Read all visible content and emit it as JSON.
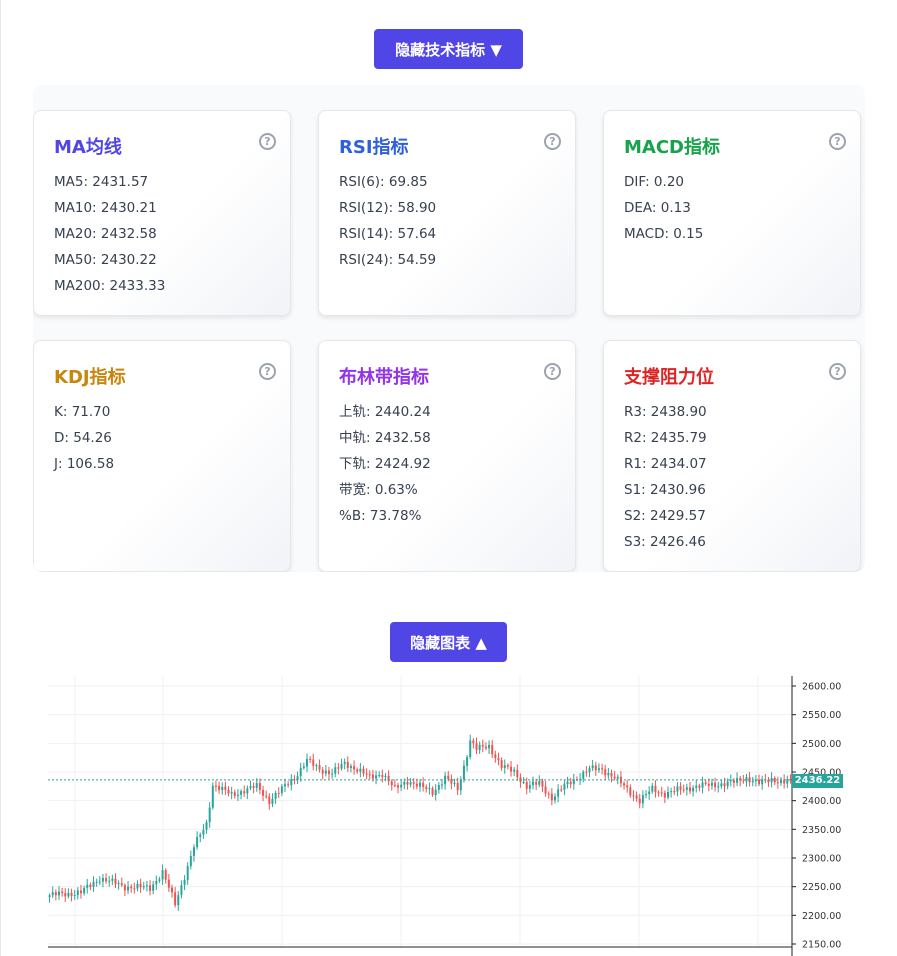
{
  "indicators_toggle": {
    "label": "隐藏技术指标 ▼"
  },
  "chart_toggle": {
    "label": "隐藏图表 ▲"
  },
  "cards": [
    {
      "title": "MA均线",
      "color": "#5046e5",
      "rows": [
        "MA5: 2431.57",
        "MA10: 2430.21",
        "MA20: 2432.58",
        "MA50: 2430.22",
        "MA200: 2433.33"
      ]
    },
    {
      "title": "RSI指标",
      "color": "#2f5fd9",
      "rows": [
        "RSI(6): 69.85",
        "RSI(12): 58.90",
        "RSI(14): 57.64",
        "RSI(24): 54.59"
      ]
    },
    {
      "title": "MACD指标",
      "color": "#16a34a",
      "rows": [
        "DIF: 0.20",
        "DEA: 0.13",
        "MACD: 0.15"
      ]
    },
    {
      "title": "KDJ指标",
      "color": "#c8860d",
      "rows": [
        "K: 71.70",
        "D: 54.26",
        "J: 106.58"
      ]
    },
    {
      "title": "布林带指标",
      "color": "#9333ea",
      "rows": [
        "上轨: 2440.24",
        "中轨: 2432.58",
        "下轨: 2424.92",
        "带宽: 0.63%",
        "%B: 73.78%"
      ]
    },
    {
      "title": "支撑阻力位",
      "color": "#dc2626",
      "rows": [
        "R3: 2438.90",
        "R2: 2435.79",
        "R1: 2434.07",
        "S1: 2430.96",
        "S2: 2429.57",
        "S3: 2426.46"
      ]
    }
  ],
  "help_glyph": "?",
  "chart_data": {
    "type": "candlestick",
    "y_ticks": [
      "2600.00",
      "2550.00",
      "2500.00",
      "2450.00",
      "2400.00",
      "2350.00",
      "2300.00",
      "2250.00",
      "2200.00",
      "2150.00"
    ],
    "ylim": [
      2150,
      2600
    ],
    "last_price": "2436.22",
    "up_color": "#26a69a",
    "down_color": "#ef5350",
    "anchors": [
      [
        0,
        2235
      ],
      [
        10,
        2240
      ],
      [
        16,
        2265
      ],
      [
        24,
        2250
      ],
      [
        32,
        2248
      ],
      [
        36,
        2275
      ],
      [
        40,
        2220
      ],
      [
        44,
        2285
      ],
      [
        46,
        2320
      ],
      [
        50,
        2360
      ],
      [
        52,
        2428
      ],
      [
        58,
        2410
      ],
      [
        62,
        2418
      ],
      [
        66,
        2425
      ],
      [
        70,
        2400
      ],
      [
        74,
        2420
      ],
      [
        78,
        2440
      ],
      [
        82,
        2470
      ],
      [
        86,
        2455
      ],
      [
        90,
        2448
      ],
      [
        94,
        2465
      ],
      [
        98,
        2455
      ],
      [
        102,
        2440
      ],
      [
        106,
        2448
      ],
      [
        110,
        2420
      ],
      [
        114,
        2435
      ],
      [
        118,
        2425
      ],
      [
        122,
        2415
      ],
      [
        126,
        2440
      ],
      [
        130,
        2420
      ],
      [
        132,
        2460
      ],
      [
        134,
        2505
      ],
      [
        136,
        2490
      ],
      [
        140,
        2495
      ],
      [
        144,
        2460
      ],
      [
        148,
        2450
      ],
      [
        152,
        2425
      ],
      [
        156,
        2430
      ],
      [
        160,
        2405
      ],
      [
        164,
        2425
      ],
      [
        168,
        2440
      ],
      [
        172,
        2455
      ],
      [
        176,
        2455
      ],
      [
        180,
        2440
      ],
      [
        184,
        2420
      ],
      [
        188,
        2400
      ],
      [
        192,
        2420
      ],
      [
        196,
        2412
      ],
      [
        200,
        2418
      ],
      [
        206,
        2425
      ],
      [
        212,
        2428
      ],
      [
        218,
        2432
      ],
      [
        222,
        2440
      ],
      [
        226,
        2430
      ],
      [
        230,
        2438
      ],
      [
        234,
        2432
      ],
      [
        236,
        2436
      ]
    ]
  }
}
